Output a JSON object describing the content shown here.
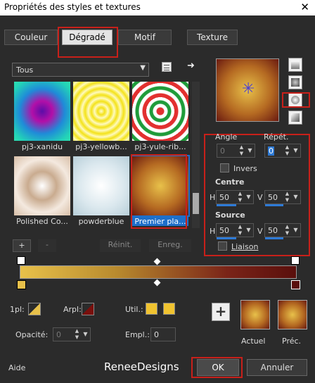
{
  "window": {
    "title": "Propriétés des styles et textures",
    "close": "✕"
  },
  "tabs": [
    "Couleur",
    "Dégradé",
    "Motif",
    "Texture"
  ],
  "library": {
    "category": "Tous",
    "items": [
      {
        "label": "pj3-xanidu"
      },
      {
        "label": "pj3-yellowb..."
      },
      {
        "label": "pj3-yule-rib..."
      },
      {
        "label": "Polished Co..."
      },
      {
        "label": "powderblue"
      },
      {
        "label": "Premier pla..."
      }
    ],
    "add": "+",
    "remove": "-",
    "reset": "Réinit.",
    "save": "Enreg."
  },
  "settings": {
    "angle_label": "Angle",
    "angle_value": "0",
    "repeat_label": "Répét.",
    "repeat_value": "0",
    "invert_label": "Invers",
    "center_label": "Centre",
    "center_h": "50",
    "center_v": "50",
    "source_label": "Source",
    "source_h": "50",
    "source_v": "50",
    "h_label": "H",
    "v_label": "V",
    "link_label": "Liaison"
  },
  "bottom": {
    "plan1_label": "1pl:",
    "arrplan_label": "Arpl:",
    "util_label": "Util.:",
    "opacity_label": "Opacité:",
    "opacity_value": "0",
    "empl_label": "Empl.:",
    "empl_value": "0",
    "current_label": "Actuel",
    "previous_label": "Préc.",
    "add_symbol": "+"
  },
  "footer": {
    "help": "Aide",
    "brand": "ReneeDesigns",
    "ok": "OK",
    "cancel": "Annuler"
  },
  "colors": {
    "accent_red": "#c8201a",
    "selection_blue": "#1e6fc9",
    "gradient_light": "#e8c14a",
    "gradient_dark": "#5a0f0c"
  }
}
